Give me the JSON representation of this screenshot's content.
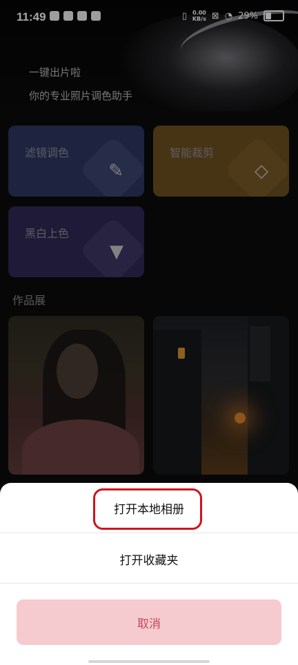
{
  "status_bar": {
    "time": "11:49",
    "net_speed_value": "0.00",
    "net_speed_unit": "KB/s",
    "battery": "29%",
    "battery_level": 0.29
  },
  "hero": {
    "line1": "一键出片啦",
    "line2": "你的专业照片调色助手"
  },
  "cards": [
    {
      "label": "滤镜调色",
      "icon": "magic-wand-icon"
    },
    {
      "label": "智能裁剪",
      "icon": "crop-icon"
    },
    {
      "label": "黑白上色",
      "icon": "paint-bucket-icon"
    }
  ],
  "section_title": "作品展",
  "sheet": {
    "option1": "打开本地相册",
    "option2": "打开收藏夹",
    "cancel": "取消"
  },
  "colors": {
    "highlight": "#d0131b",
    "cancel_bg": "#f6cbd0",
    "cancel_text": "#c24a57"
  }
}
